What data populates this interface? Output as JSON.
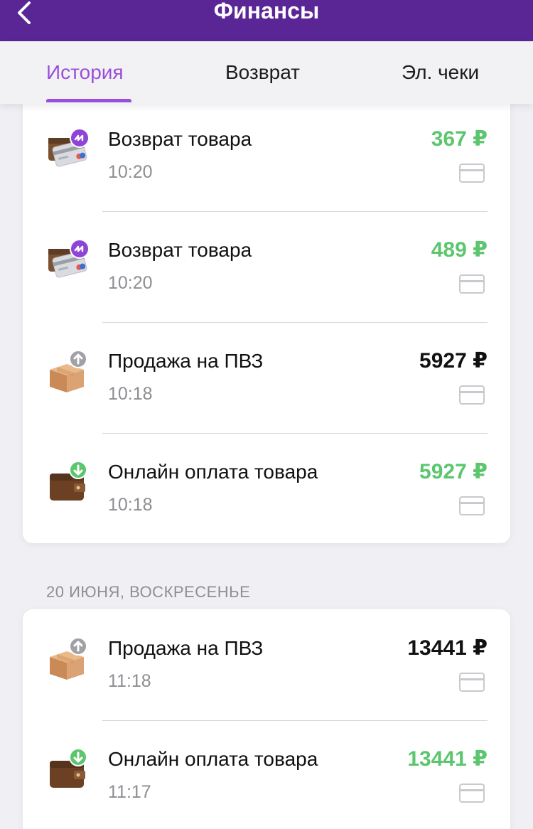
{
  "header": {
    "title": "Финансы",
    "back_icon": "chevron-left-icon"
  },
  "tabs": [
    {
      "label": "История",
      "active": true
    },
    {
      "label": "Возврат",
      "active": false
    },
    {
      "label": "Эл. чеки",
      "active": false
    }
  ],
  "colors": {
    "brand": "#5a2595",
    "accent": "#9a4fd8",
    "positive": "#5cc66f"
  },
  "groups": [
    {
      "date": "",
      "items": [
        {
          "title": "Возврат товара",
          "time": "10:20",
          "amount": "367 ₽",
          "tone": "green",
          "icon": "refund-card-icon"
        },
        {
          "title": "Возврат товара",
          "time": "10:20",
          "amount": "489 ₽",
          "tone": "green",
          "icon": "refund-card-icon"
        },
        {
          "title": "Продажа на ПВЗ",
          "time": "10:18",
          "amount": "5927 ₽",
          "tone": "dark",
          "icon": "box-upload-icon"
        },
        {
          "title": "Онлайн оплата товара",
          "time": "10:18",
          "amount": "5927 ₽",
          "tone": "green",
          "icon": "wallet-download-icon"
        }
      ]
    },
    {
      "date": "20 ИЮНЯ, ВОСКРЕСЕНЬЕ",
      "items": [
        {
          "title": "Продажа на ПВЗ",
          "time": "11:18",
          "amount": "13441 ₽",
          "tone": "dark",
          "icon": "box-upload-icon"
        },
        {
          "title": "Онлайн оплата товара",
          "time": "11:17",
          "amount": "13441 ₽",
          "tone": "green",
          "icon": "wallet-download-icon"
        }
      ]
    }
  ]
}
